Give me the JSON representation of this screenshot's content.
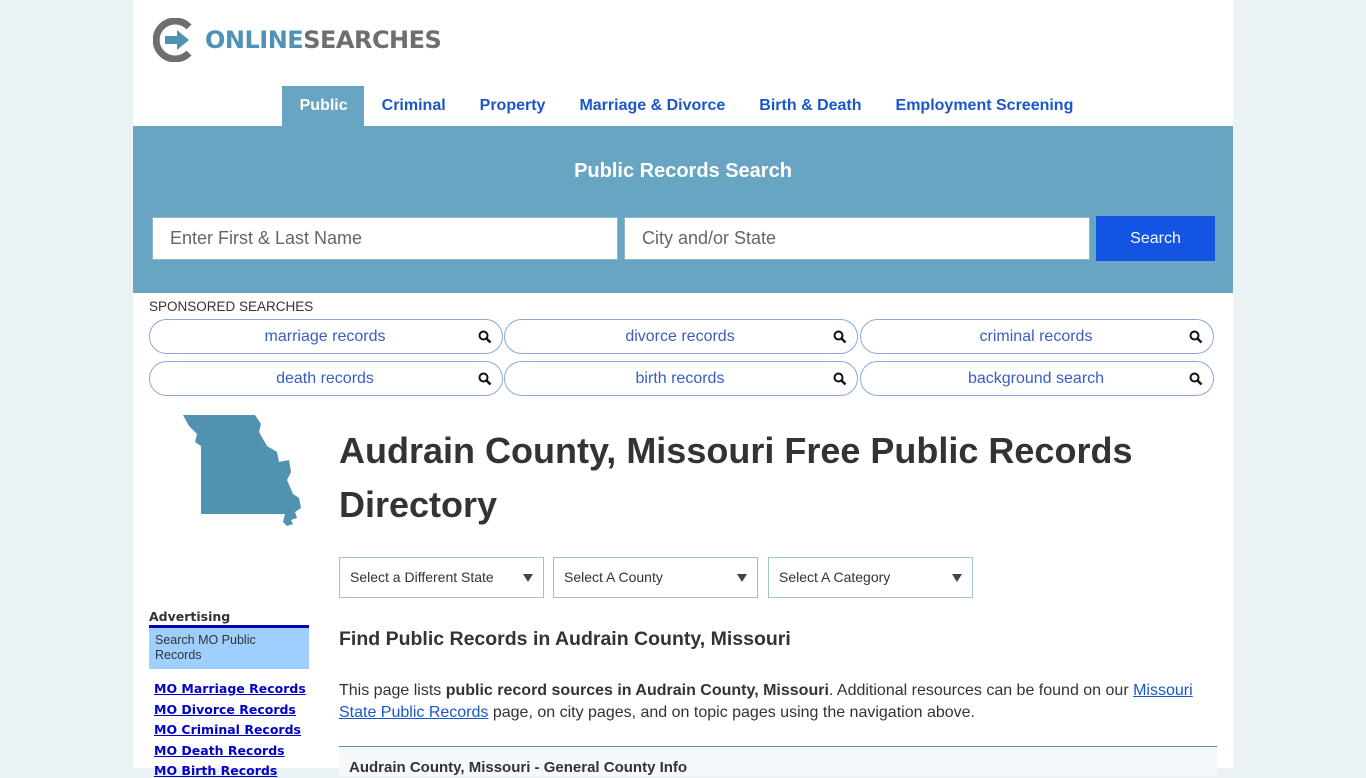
{
  "brand": {
    "logo_part1": "ONLINE",
    "logo_part2": "SEARCHES",
    "colors": {
      "primary": "#4e93b5",
      "secondary": "#6d6e70",
      "banner": "#67a5c2",
      "button": "#1354e3"
    }
  },
  "nav": {
    "items": [
      {
        "label": "Public",
        "active": true
      },
      {
        "label": "Criminal"
      },
      {
        "label": "Property"
      },
      {
        "label": "Marriage & Divorce"
      },
      {
        "label": "Birth & Death"
      },
      {
        "label": "Employment Screening"
      }
    ]
  },
  "search": {
    "title": "Public Records Search",
    "name_placeholder": "Enter First & Last Name",
    "name_value": "",
    "location_placeholder": "City and/or State",
    "location_value": "",
    "button_label": "Search"
  },
  "sponsored": {
    "label": "SPONSORED SEARCHES",
    "items": [
      {
        "label": "marriage records",
        "icon": "search-icon"
      },
      {
        "label": "divorce records",
        "icon": "search-icon"
      },
      {
        "label": "criminal records",
        "icon": "search-icon"
      },
      {
        "label": "death records",
        "icon": "search-icon"
      },
      {
        "label": "birth records",
        "icon": "search-icon"
      },
      {
        "label": "background search",
        "icon": "search-icon"
      }
    ]
  },
  "main": {
    "state_icon": "missouri-state-map",
    "title": "Audrain County, Missouri Free Public Records Directory",
    "selects": [
      {
        "selected": "Select a Different State"
      },
      {
        "selected": "Select A County"
      },
      {
        "selected": "Select A Category"
      }
    ],
    "find_heading": "Find Public Records in Audrain County, Missouri",
    "intro": {
      "prefix": "This page lists ",
      "bold": "public record sources in Audrain County, Missouri",
      "middle": ". Additional resources can be found on our ",
      "link": "Missouri State Public Records",
      "suffix": " page, on city pages, and on topic pages using the navigation above."
    },
    "section_heading": "Audrain County, Missouri - General County Info"
  },
  "sidebar": {
    "advertising_label": "Advertising",
    "ad_box_text": "Search MO Public Records",
    "links": [
      "MO Marriage Records",
      "MO Divorce Records",
      "MO Criminal Records",
      "MO Death Records",
      "MO Birth Records"
    ]
  }
}
